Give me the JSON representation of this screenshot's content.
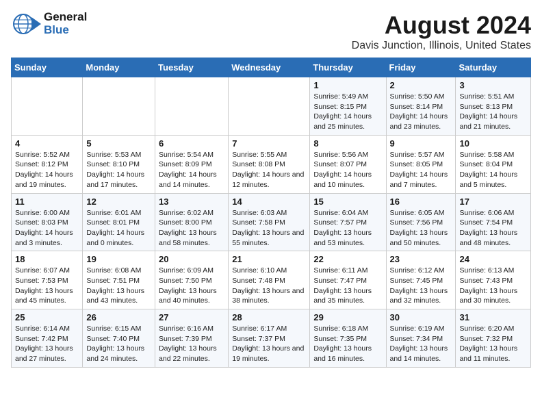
{
  "header": {
    "logo_line1": "General",
    "logo_line2": "Blue",
    "main_title": "August 2024",
    "subtitle": "Davis Junction, Illinois, United States"
  },
  "calendar": {
    "days_of_week": [
      "Sunday",
      "Monday",
      "Tuesday",
      "Wednesday",
      "Thursday",
      "Friday",
      "Saturday"
    ],
    "weeks": [
      [
        {
          "num": "",
          "info": ""
        },
        {
          "num": "",
          "info": ""
        },
        {
          "num": "",
          "info": ""
        },
        {
          "num": "",
          "info": ""
        },
        {
          "num": "1",
          "info": "Sunrise: 5:49 AM\nSunset: 8:15 PM\nDaylight: 14 hours and 25 minutes."
        },
        {
          "num": "2",
          "info": "Sunrise: 5:50 AM\nSunset: 8:14 PM\nDaylight: 14 hours and 23 minutes."
        },
        {
          "num": "3",
          "info": "Sunrise: 5:51 AM\nSunset: 8:13 PM\nDaylight: 14 hours and 21 minutes."
        }
      ],
      [
        {
          "num": "4",
          "info": "Sunrise: 5:52 AM\nSunset: 8:12 PM\nDaylight: 14 hours and 19 minutes."
        },
        {
          "num": "5",
          "info": "Sunrise: 5:53 AM\nSunset: 8:10 PM\nDaylight: 14 hours and 17 minutes."
        },
        {
          "num": "6",
          "info": "Sunrise: 5:54 AM\nSunset: 8:09 PM\nDaylight: 14 hours and 14 minutes."
        },
        {
          "num": "7",
          "info": "Sunrise: 5:55 AM\nSunset: 8:08 PM\nDaylight: 14 hours and 12 minutes."
        },
        {
          "num": "8",
          "info": "Sunrise: 5:56 AM\nSunset: 8:07 PM\nDaylight: 14 hours and 10 minutes."
        },
        {
          "num": "9",
          "info": "Sunrise: 5:57 AM\nSunset: 8:05 PM\nDaylight: 14 hours and 7 minutes."
        },
        {
          "num": "10",
          "info": "Sunrise: 5:58 AM\nSunset: 8:04 PM\nDaylight: 14 hours and 5 minutes."
        }
      ],
      [
        {
          "num": "11",
          "info": "Sunrise: 6:00 AM\nSunset: 8:03 PM\nDaylight: 14 hours and 3 minutes."
        },
        {
          "num": "12",
          "info": "Sunrise: 6:01 AM\nSunset: 8:01 PM\nDaylight: 14 hours and 0 minutes."
        },
        {
          "num": "13",
          "info": "Sunrise: 6:02 AM\nSunset: 8:00 PM\nDaylight: 13 hours and 58 minutes."
        },
        {
          "num": "14",
          "info": "Sunrise: 6:03 AM\nSunset: 7:58 PM\nDaylight: 13 hours and 55 minutes."
        },
        {
          "num": "15",
          "info": "Sunrise: 6:04 AM\nSunset: 7:57 PM\nDaylight: 13 hours and 53 minutes."
        },
        {
          "num": "16",
          "info": "Sunrise: 6:05 AM\nSunset: 7:56 PM\nDaylight: 13 hours and 50 minutes."
        },
        {
          "num": "17",
          "info": "Sunrise: 6:06 AM\nSunset: 7:54 PM\nDaylight: 13 hours and 48 minutes."
        }
      ],
      [
        {
          "num": "18",
          "info": "Sunrise: 6:07 AM\nSunset: 7:53 PM\nDaylight: 13 hours and 45 minutes."
        },
        {
          "num": "19",
          "info": "Sunrise: 6:08 AM\nSunset: 7:51 PM\nDaylight: 13 hours and 43 minutes."
        },
        {
          "num": "20",
          "info": "Sunrise: 6:09 AM\nSunset: 7:50 PM\nDaylight: 13 hours and 40 minutes."
        },
        {
          "num": "21",
          "info": "Sunrise: 6:10 AM\nSunset: 7:48 PM\nDaylight: 13 hours and 38 minutes."
        },
        {
          "num": "22",
          "info": "Sunrise: 6:11 AM\nSunset: 7:47 PM\nDaylight: 13 hours and 35 minutes."
        },
        {
          "num": "23",
          "info": "Sunrise: 6:12 AM\nSunset: 7:45 PM\nDaylight: 13 hours and 32 minutes."
        },
        {
          "num": "24",
          "info": "Sunrise: 6:13 AM\nSunset: 7:43 PM\nDaylight: 13 hours and 30 minutes."
        }
      ],
      [
        {
          "num": "25",
          "info": "Sunrise: 6:14 AM\nSunset: 7:42 PM\nDaylight: 13 hours and 27 minutes."
        },
        {
          "num": "26",
          "info": "Sunrise: 6:15 AM\nSunset: 7:40 PM\nDaylight: 13 hours and 24 minutes."
        },
        {
          "num": "27",
          "info": "Sunrise: 6:16 AM\nSunset: 7:39 PM\nDaylight: 13 hours and 22 minutes."
        },
        {
          "num": "28",
          "info": "Sunrise: 6:17 AM\nSunset: 7:37 PM\nDaylight: 13 hours and 19 minutes."
        },
        {
          "num": "29",
          "info": "Sunrise: 6:18 AM\nSunset: 7:35 PM\nDaylight: 13 hours and 16 minutes."
        },
        {
          "num": "30",
          "info": "Sunrise: 6:19 AM\nSunset: 7:34 PM\nDaylight: 13 hours and 14 minutes."
        },
        {
          "num": "31",
          "info": "Sunrise: 6:20 AM\nSunset: 7:32 PM\nDaylight: 13 hours and 11 minutes."
        }
      ]
    ]
  }
}
